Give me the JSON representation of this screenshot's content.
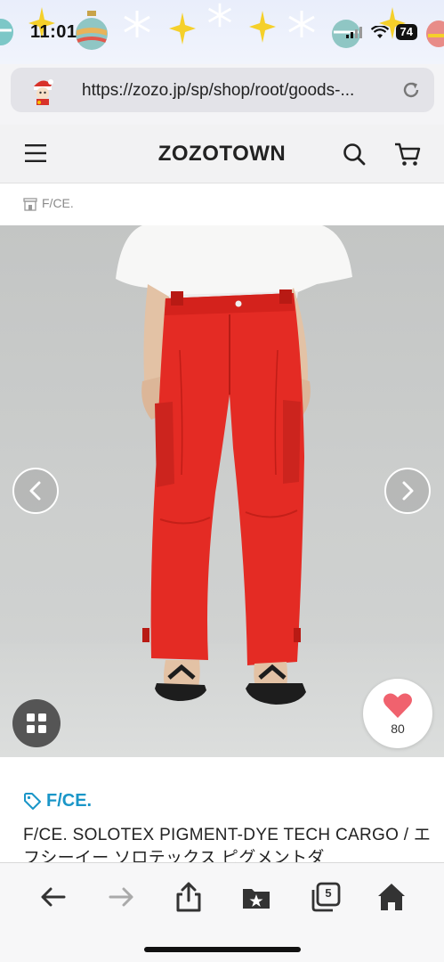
{
  "status_bar": {
    "time": "11:01",
    "battery": "74"
  },
  "browser": {
    "url": "https://zozo.jp/sp/shop/root/goods-..."
  },
  "header": {
    "logo": "ZOZOTOWN",
    "icons": [
      "menu-icon",
      "search-icon",
      "cart-icon"
    ]
  },
  "shop": {
    "label": "F/CE."
  },
  "product": {
    "brand": "F/CE.",
    "title": "F/CE. SOLOTEX PIGMENT-DYE TECH CARGO / エフシーイー ソロテックス ピグメントダ",
    "favorite_count": "80",
    "pants_color": "#e42b24",
    "brand_color": "#1a96c8"
  },
  "toolbar": {
    "tabs_count": "5",
    "icons": [
      "back-icon",
      "forward-icon",
      "share-icon",
      "bookmarks-icon",
      "tabs-icon",
      "home-icon"
    ]
  }
}
